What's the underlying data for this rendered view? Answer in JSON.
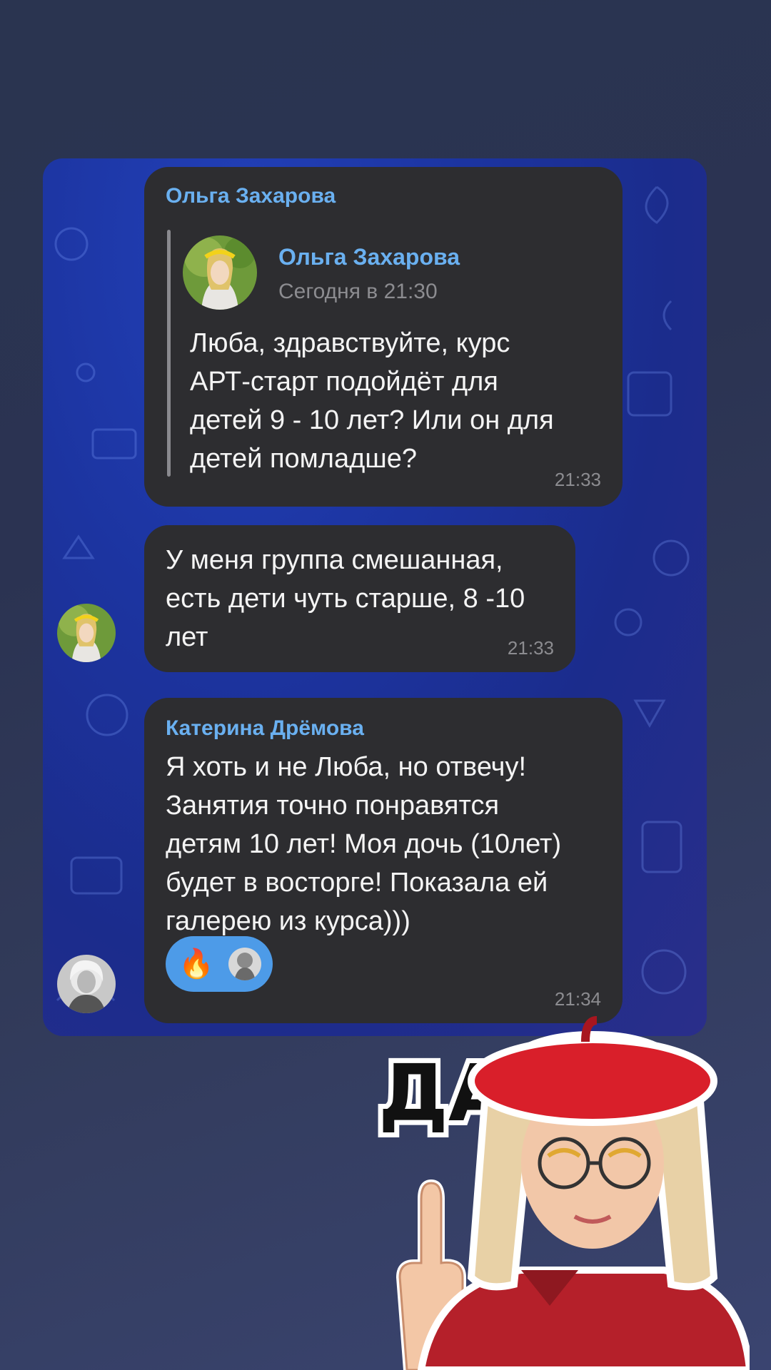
{
  "messages": [
    {
      "sender": "Ольга Захарова",
      "reply": {
        "author": "Ольга Захарова",
        "date": "Сегодня в 21:30",
        "text_lines": [
          "Люба, здравствуйте, курс",
          "АРТ-старт подойдёт для",
          "детей 9 - 10 лет? Или он для",
          "детей помладше?"
        ]
      },
      "time": "21:33"
    },
    {
      "text_lines": [
        "У меня группа смешанная,",
        "есть дети чуть старше, 8 -10",
        "лет"
      ],
      "time": "21:33"
    },
    {
      "sender": "Катерина Дрёмова",
      "text_lines": [
        "Я хоть и не Люба, но отвечу!",
        "Занятия точно понравятся",
        "детям 10 лет! Моя дочь (10лет)",
        "будет в восторге! Показала ей",
        "галерею из курса)))"
      ],
      "reaction": "🔥",
      "time": "21:34"
    }
  ],
  "sticker": {
    "text": "ДА",
    "icon": "girl-red-beret-sticker"
  },
  "colors": {
    "bubble": "#2d2d30",
    "sender": "#6ab0f0",
    "reaction": "#4d9be8",
    "sticker_beret": "#d91f2a"
  }
}
